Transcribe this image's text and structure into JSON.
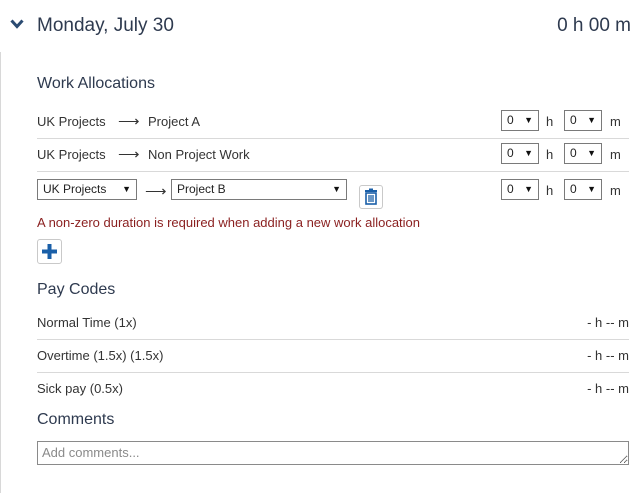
{
  "header": {
    "day_title": "Monday, July 30",
    "total": "0 h 00 m"
  },
  "allocations": {
    "title": "Work Allocations",
    "rows": [
      {
        "category": "UK Projects",
        "arrow": "⟶",
        "project": "Project A",
        "hours": "0",
        "minutes": "0"
      },
      {
        "category": "UK Projects",
        "arrow": "⟶",
        "project": "Non Project Work",
        "hours": "0",
        "minutes": "0"
      }
    ],
    "new_row": {
      "category": "UK Projects",
      "arrow": "⟶",
      "project": "Project B",
      "hours": "0",
      "minutes": "0"
    },
    "hours_unit": "h",
    "minutes_unit": "m",
    "error": "A non-zero duration is required when adding a new work allocation"
  },
  "pay_codes": {
    "title": "Pay Codes",
    "items": [
      {
        "name": "Normal Time (1x)",
        "duration": "- h -- m"
      },
      {
        "name": "Overtime (1.5x) (1.5x)",
        "duration": "- h -- m"
      },
      {
        "name": "Sick pay (0.5x)",
        "duration": "- h -- m"
      }
    ]
  },
  "comments": {
    "title": "Comments",
    "placeholder": "Add comments...",
    "value": ""
  },
  "colors": {
    "title": "#2e3a4f",
    "error": "#8a1f1f",
    "accent": "#1a5fa8"
  },
  "icons": {
    "collapse": "chevron-down-icon",
    "delete": "trash-icon",
    "add": "plus-icon"
  }
}
